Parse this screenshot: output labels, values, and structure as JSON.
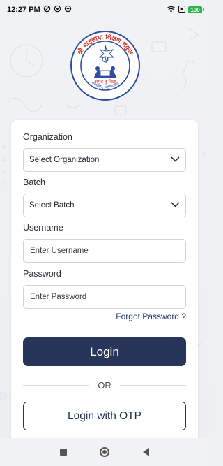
{
  "status_bar": {
    "time": "12:27 PM",
    "battery": "100"
  },
  "logo": {
    "top_arc_text": "श्री मातृछाया शिक्षण संकुल",
    "motto": "अमृतं तु विद्या",
    "bottom_text": "मोरवीपुर, अहमदाबाद"
  },
  "form": {
    "organization": {
      "label": "Organization",
      "value": "Select Organization"
    },
    "batch": {
      "label": "Batch",
      "value": "Select Batch"
    },
    "username": {
      "label": "Username",
      "placeholder": "Enter Username"
    },
    "password": {
      "label": "Password",
      "placeholder": "Enter Password"
    },
    "forgot_password": "Forgot Password ?",
    "login_button": "Login",
    "or_text": "OR",
    "otp_button": "Login with OTP"
  },
  "colors": {
    "primary": "#27355a",
    "battery": "#2db34a",
    "logo_blue": "#2d4fa1",
    "logo_red": "#d23a2a"
  },
  "icons": {
    "status_left": [
      "dnd-icon",
      "sync-icon",
      "notification-icon"
    ],
    "status_right": [
      "wifi-icon",
      "close-x-icon",
      "battery-icon"
    ],
    "dropdown": "chevron-down-icon",
    "nav": [
      "recents-square-icon",
      "home-circle-icon",
      "back-triangle-icon"
    ]
  }
}
